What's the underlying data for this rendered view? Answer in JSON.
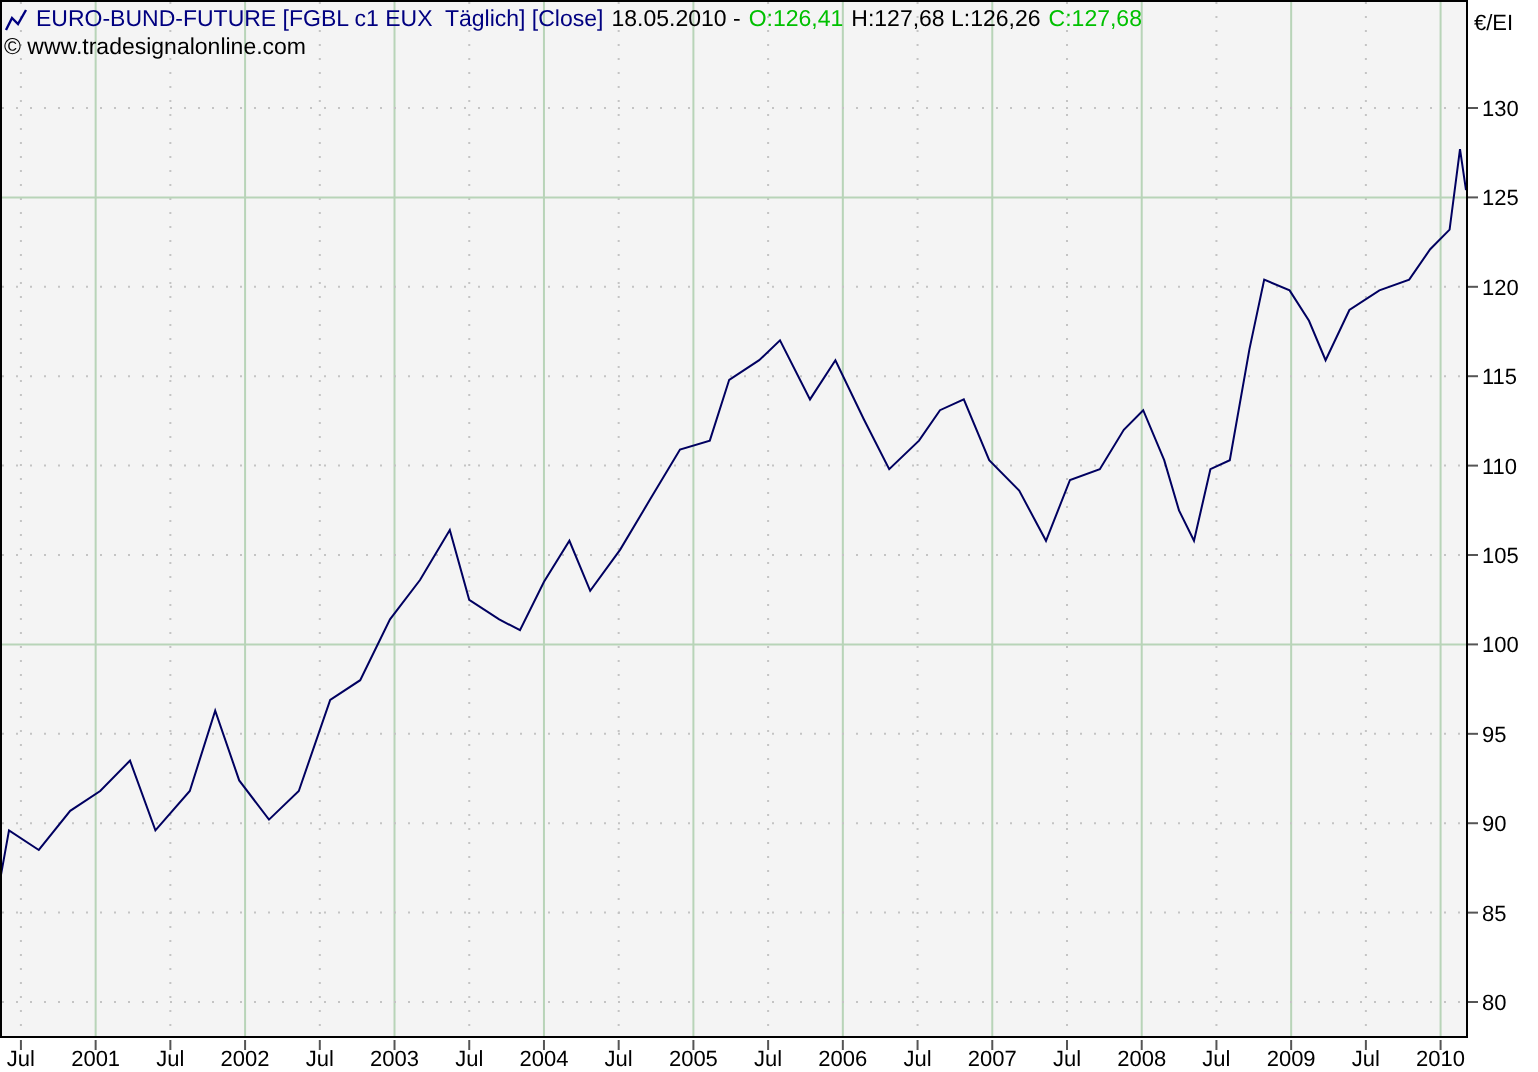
{
  "header": {
    "segments": [
      {
        "text": "EURO-BUND-FUTURE [FGBL c1 EUX  Täglich] [Close]",
        "color": "#000080"
      },
      {
        "text": "18.05.2010 -",
        "color": "#000000"
      },
      {
        "text": "O:126,41",
        "color": "#00c000"
      },
      {
        "text": "H:127,68 L:126,26",
        "color": "#000000"
      },
      {
        "text": "C:127,68",
        "color": "#00c000"
      }
    ],
    "copyright": "© www.tradesignalonline.com"
  },
  "axis_unit": "€/EI",
  "chart_data": {
    "type": "line",
    "grid": true,
    "xlim": [
      2000.36,
      2010.17
    ],
    "ylim": [
      78.1,
      136.04
    ],
    "yticks": [
      {
        "value": 80,
        "label": "80"
      },
      {
        "value": 85,
        "label": "85"
      },
      {
        "value": 90,
        "label": "90"
      },
      {
        "value": 95,
        "label": "95"
      },
      {
        "value": 100,
        "label": "100"
      },
      {
        "value": 105,
        "label": "105"
      },
      {
        "value": 110,
        "label": "110"
      },
      {
        "value": 115,
        "label": "115"
      },
      {
        "value": 120,
        "label": "120"
      },
      {
        "value": 125,
        "label": "125"
      },
      {
        "value": 130,
        "label": "130"
      }
    ],
    "xticks": [
      {
        "value": 2000.5,
        "label": "Jul"
      },
      {
        "value": 2001,
        "label": "2001"
      },
      {
        "value": 2001.5,
        "label": "Jul"
      },
      {
        "value": 2002,
        "label": "2002"
      },
      {
        "value": 2002.5,
        "label": "Jul"
      },
      {
        "value": 2003,
        "label": "2003"
      },
      {
        "value": 2003.5,
        "label": "Jul"
      },
      {
        "value": 2004,
        "label": "2004"
      },
      {
        "value": 2004.5,
        "label": "Jul"
      },
      {
        "value": 2005,
        "label": "2005"
      },
      {
        "value": 2005.5,
        "label": "Jul"
      },
      {
        "value": 2006,
        "label": "2006"
      },
      {
        "value": 2006.5,
        "label": "Jul"
      },
      {
        "value": 2007,
        "label": "2007"
      },
      {
        "value": 2007.5,
        "label": "Jul"
      },
      {
        "value": 2008,
        "label": "2008"
      },
      {
        "value": 2008.5,
        "label": "Jul"
      },
      {
        "value": 2009,
        "label": "2009"
      },
      {
        "value": 2009.5,
        "label": "Jul"
      },
      {
        "value": 2010,
        "label": "2010"
      }
    ],
    "x": [
      2000.36,
      2000.42,
      2000.62,
      2000.83,
      2001.03,
      2001.23,
      2001.4,
      2001.63,
      2001.8,
      2001.96,
      2002.16,
      2002.36,
      2002.57,
      2002.77,
      2002.97,
      2003.17,
      2003.37,
      2003.5,
      2003.7,
      2003.84,
      2004,
      2004.17,
      2004.31,
      2004.51,
      2004.71,
      2004.91,
      2005.11,
      2005.24,
      2005.44,
      2005.58,
      2005.78,
      2005.95,
      2006.14,
      2006.31,
      2006.51,
      2006.65,
      2006.81,
      2006.98,
      2007.18,
      2007.36,
      2007.52,
      2007.72,
      2007.88,
      2008.01,
      2008.15,
      2008.25,
      2008.35,
      2008.46,
      2008.59,
      2008.72,
      2008.82,
      2008.99,
      2009.12,
      2009.23,
      2009.39,
      2009.59,
      2009.79,
      2009.93,
      2010.06,
      2010.13,
      2010.17
    ],
    "series": [
      {
        "color": "#000060",
        "values": [
          86.8,
          89.6,
          88.5,
          90.7,
          91.8,
          93.5,
          89.6,
          91.8,
          96.3,
          92.4,
          90.2,
          91.8,
          96.9,
          98,
          101.4,
          103.6,
          106.4,
          102.5,
          101.4,
          100.8,
          103.5,
          105.8,
          103,
          105.3,
          108.1,
          110.9,
          111.4,
          114.8,
          115.9,
          117,
          113.7,
          115.9,
          112.6,
          109.8,
          111.4,
          113.1,
          113.7,
          110.3,
          108.6,
          105.8,
          109.2,
          109.8,
          112,
          113.1,
          110.3,
          107.5,
          105.8,
          109.8,
          110.3,
          116.5,
          120.4,
          119.8,
          118.1,
          115.9,
          118.7,
          119.8,
          120.4,
          122.1,
          123.2,
          127.7,
          125.4
        ]
      }
    ]
  }
}
